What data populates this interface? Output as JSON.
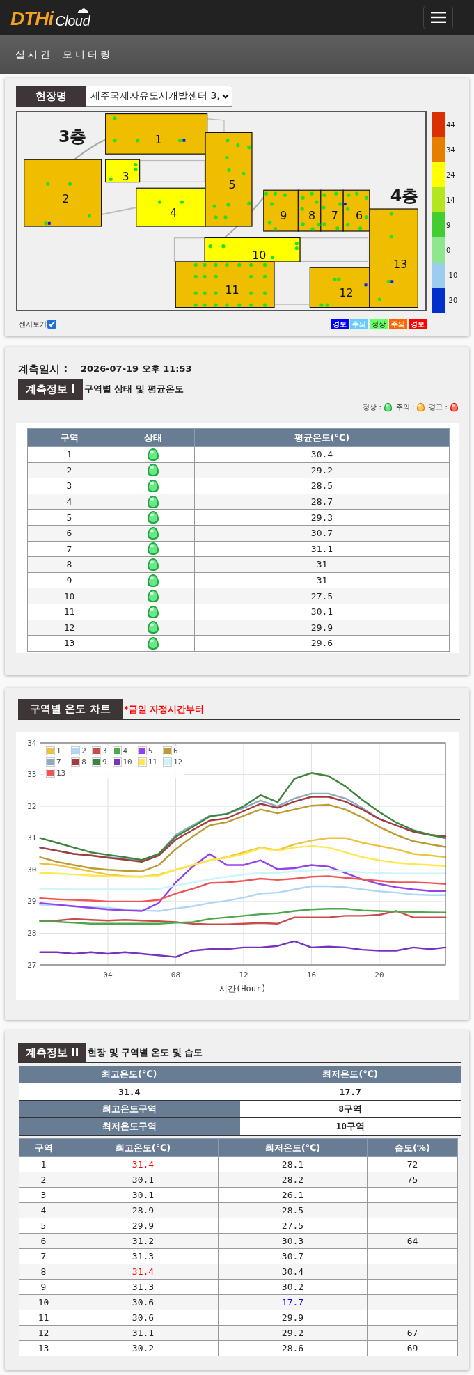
{
  "header": {
    "logo_brand": "DTHi",
    "logo_suffix": "Cloud"
  },
  "page_title": "실시간 모니터링",
  "site": {
    "label": "현장명",
    "selected_site": "제주국제자유도시개발센터 3,"
  },
  "map": {
    "floors": [
      {
        "label": "3층"
      },
      {
        "label": "4층"
      }
    ],
    "zones": [
      {
        "label": "1",
        "color": "#f0be00",
        "humidity_sensor": true
      },
      {
        "label": "2",
        "color": "#f0be00",
        "humidity_sensor": true
      },
      {
        "label": "3",
        "color": "#ffff00",
        "humidity_sensor": false
      },
      {
        "label": "4",
        "color": "#ffff00",
        "humidity_sensor": false
      },
      {
        "label": "5",
        "color": "#f0be00",
        "humidity_sensor": false
      },
      {
        "label": "9",
        "color": "#f0be00",
        "humidity_sensor": false
      },
      {
        "label": "8",
        "color": "#f0be00",
        "humidity_sensor": false
      },
      {
        "label": "7",
        "color": "#f0be00",
        "humidity_sensor": false
      },
      {
        "label": "6",
        "color": "#f0be00",
        "humidity_sensor": true
      },
      {
        "label": "10",
        "color": "#ffff00",
        "humidity_sensor": false
      },
      {
        "label": "11",
        "color": "#f0be00",
        "humidity_sensor": false
      },
      {
        "label": "12",
        "color": "#f0be00",
        "humidity_sensor": true
      },
      {
        "label": "13",
        "color": "#f0be00",
        "humidity_sensor": true
      }
    ],
    "color_scale": [
      {
        "label": "44",
        "color": "#d83000"
      },
      {
        "label": "34",
        "color": "#e67e00"
      },
      {
        "label": "24",
        "color": "#ffff00"
      },
      {
        "label": "14",
        "color": "#b4e61e"
      },
      {
        "label": "9",
        "color": "#44cc33"
      },
      {
        "label": "0",
        "color": "#8ee68e"
      },
      {
        "label": "-10",
        "color": "#9cccf0"
      },
      {
        "label": "-20",
        "color": "#0030cc"
      }
    ],
    "sensor_toggle": {
      "label": "센서보기",
      "checked": true
    },
    "alert_legend": [
      {
        "label": "경보",
        "color": "#0000ff"
      },
      {
        "label": "주의",
        "color": "#66ccff"
      },
      {
        "label": "정상",
        "color": "#66ff66"
      },
      {
        "label": "주의",
        "color": "#ff6600"
      },
      {
        "label": "경보",
        "color": "#ff0000"
      }
    ]
  },
  "measurement": {
    "time_label": "계측일시 :",
    "time": "2026-07-19 오후 11:53",
    "tab": "계측정보 I",
    "subtitle": "구역별 상태 및 평균온도",
    "status_legend": [
      {
        "label": "정상 :",
        "kind": "normal"
      },
      {
        "label": "주의 :",
        "kind": "caution"
      },
      {
        "label": "경고 :",
        "kind": "warning"
      }
    ],
    "table": {
      "columns": [
        "구역",
        "상태",
        "평균온도(℃)"
      ],
      "rows": [
        {
          "zone": "1",
          "kind": "normal",
          "avg": "30.4"
        },
        {
          "zone": "2",
          "kind": "normal",
          "avg": "29.2"
        },
        {
          "zone": "3",
          "kind": "normal",
          "avg": "28.5"
        },
        {
          "zone": "4",
          "kind": "normal",
          "avg": "28.7"
        },
        {
          "zone": "5",
          "kind": "normal",
          "avg": "29.3"
        },
        {
          "zone": "6",
          "kind": "normal",
          "avg": "30.7"
        },
        {
          "zone": "7",
          "kind": "normal",
          "avg": "31.1"
        },
        {
          "zone": "8",
          "kind": "normal",
          "avg": "31"
        },
        {
          "zone": "9",
          "kind": "normal",
          "avg": "31"
        },
        {
          "zone": "10",
          "kind": "normal",
          "avg": "27.5"
        },
        {
          "zone": "11",
          "kind": "normal",
          "avg": "30.1"
        },
        {
          "zone": "12",
          "kind": "normal",
          "avg": "29.9"
        },
        {
          "zone": "13",
          "kind": "normal",
          "avg": "29.6"
        }
      ]
    }
  },
  "chart_section": {
    "tab": "구역별 온도 차트",
    "note": "*금일 자정시간부터",
    "chart_data": {
      "type": "line",
      "xlabel": "시간(Hour)",
      "grid": true,
      "legend": true,
      "x": [
        0,
        1,
        2,
        3,
        4,
        5,
        6,
        7,
        8,
        9,
        10,
        11,
        12,
        13,
        14,
        15,
        16,
        17,
        18,
        19,
        20,
        21,
        22,
        23,
        23.9
      ],
      "xlim": [
        0,
        23.9
      ],
      "ylim": [
        27,
        34
      ],
      "xticks": [
        {
          "value": 4,
          "label": "04"
        },
        {
          "value": 8,
          "label": "08"
        },
        {
          "value": 12,
          "label": "12"
        },
        {
          "value": 16,
          "label": "16"
        },
        {
          "value": 20,
          "label": "20"
        }
      ],
      "yticks": [
        {
          "value": 27,
          "label": "27"
        },
        {
          "value": 28,
          "label": "28"
        },
        {
          "value": 29,
          "label": "29"
        },
        {
          "value": 30,
          "label": "30"
        },
        {
          "value": 31,
          "label": "31"
        },
        {
          "value": 32,
          "label": "32"
        },
        {
          "value": 33,
          "label": "33"
        },
        {
          "value": 34,
          "label": "34"
        }
      ],
      "series": [
        {
          "name": "1",
          "color": "#edc240",
          "values": [
            30.2,
            30.15,
            30.05,
            29.95,
            29.85,
            29.8,
            29.78,
            29.85,
            30.0,
            30.15,
            30.3,
            30.4,
            30.55,
            30.7,
            30.62,
            30.8,
            30.92,
            31.0,
            31.0,
            30.85,
            30.75,
            30.65,
            30.5,
            30.45,
            30.4
          ]
        },
        {
          "name": "2",
          "color": "#afd8f8",
          "values": [
            28.9,
            28.88,
            28.85,
            28.82,
            28.8,
            28.75,
            28.72,
            28.7,
            28.78,
            28.85,
            28.95,
            29.02,
            29.12,
            29.25,
            29.28,
            29.38,
            29.48,
            29.48,
            29.45,
            29.38,
            29.32,
            29.28,
            29.22,
            29.2,
            29.2
          ]
        },
        {
          "name": "3",
          "color": "#cb4b4b",
          "values": [
            28.4,
            28.4,
            28.45,
            28.42,
            28.4,
            28.42,
            28.4,
            28.38,
            28.35,
            28.3,
            28.28,
            28.28,
            28.3,
            28.32,
            28.3,
            28.5,
            28.5,
            28.5,
            28.55,
            28.55,
            28.58,
            28.7,
            28.5,
            28.5,
            28.5
          ]
        },
        {
          "name": "4",
          "color": "#4da74d",
          "values": [
            28.38,
            28.36,
            28.33,
            28.3,
            28.3,
            28.3,
            28.3,
            28.3,
            28.33,
            28.35,
            28.45,
            28.5,
            28.55,
            28.6,
            28.63,
            28.7,
            28.75,
            28.77,
            28.77,
            28.72,
            28.7,
            28.68,
            28.67,
            28.66,
            28.65
          ]
        },
        {
          "name": "5",
          "color": "#9440ed",
          "values": [
            28.95,
            28.9,
            28.85,
            28.8,
            28.75,
            28.72,
            28.7,
            28.95,
            29.6,
            30.1,
            30.5,
            30.15,
            30.15,
            30.3,
            30.02,
            30.05,
            30.15,
            30.1,
            29.9,
            29.7,
            29.55,
            29.45,
            29.38,
            29.33,
            29.33
          ]
        },
        {
          "name": "6",
          "color": "#bd9b33",
          "values": [
            30.4,
            30.25,
            30.15,
            30.05,
            30.0,
            29.97,
            29.95,
            30.15,
            30.65,
            31.05,
            31.4,
            31.5,
            31.7,
            31.9,
            31.78,
            31.9,
            32.02,
            32.05,
            31.9,
            31.65,
            31.35,
            31.1,
            30.9,
            30.8,
            30.72
          ]
        },
        {
          "name": "7",
          "color": "#8cacc6",
          "values": [
            30.7,
            30.6,
            30.5,
            30.45,
            30.4,
            30.35,
            30.28,
            30.5,
            31.1,
            31.4,
            31.7,
            31.75,
            31.95,
            32.18,
            32.0,
            32.25,
            32.4,
            32.4,
            32.25,
            31.95,
            31.6,
            31.4,
            31.2,
            31.1,
            31.05
          ]
        },
        {
          "name": "8",
          "color": "#a23c3c",
          "values": [
            30.7,
            30.6,
            30.5,
            30.45,
            30.38,
            30.32,
            30.25,
            30.45,
            30.95,
            31.25,
            31.55,
            31.62,
            31.85,
            32.08,
            31.95,
            32.15,
            32.3,
            32.3,
            32.15,
            31.9,
            31.6,
            31.4,
            31.2,
            31.1,
            31.05
          ]
        },
        {
          "name": "9",
          "color": "#3d853d",
          "values": [
            31.0,
            30.85,
            30.7,
            30.55,
            30.47,
            30.4,
            30.31,
            30.5,
            31.04,
            31.35,
            31.68,
            31.76,
            32.0,
            32.35,
            32.13,
            32.87,
            33.05,
            32.95,
            32.63,
            32.2,
            31.82,
            31.49,
            31.25,
            31.1,
            31.0
          ]
        },
        {
          "name": "10",
          "color": "#7633bd",
          "values": [
            27.4,
            27.4,
            27.35,
            27.4,
            27.35,
            27.4,
            27.35,
            27.3,
            27.25,
            27.45,
            27.5,
            27.5,
            27.55,
            27.55,
            27.6,
            27.75,
            27.55,
            27.58,
            27.55,
            27.48,
            27.45,
            27.45,
            27.55,
            27.5,
            27.55
          ]
        },
        {
          "name": "11",
          "color": "#ffe84c",
          "values": [
            29.9,
            29.88,
            29.85,
            29.82,
            29.8,
            29.78,
            29.78,
            29.82,
            30.0,
            30.15,
            30.3,
            30.38,
            30.5,
            30.68,
            30.6,
            30.7,
            30.75,
            30.7,
            30.55,
            30.4,
            30.3,
            30.22,
            30.18,
            30.15,
            30.12
          ]
        },
        {
          "name": "12",
          "color": "#c8f6fa",
          "values": [
            29.4,
            29.4,
            29.38,
            29.38,
            29.38,
            29.38,
            29.38,
            29.4,
            29.5,
            29.6,
            29.7,
            29.78,
            29.85,
            29.9,
            29.9,
            29.95,
            29.98,
            30.0,
            29.95,
            29.92,
            29.9,
            29.88,
            29.88,
            29.88,
            29.88
          ]
        },
        {
          "name": "13",
          "color": "#f05555",
          "values": [
            29.1,
            29.07,
            29.05,
            29.03,
            29.0,
            29.0,
            29.0,
            29.05,
            29.25,
            29.4,
            29.58,
            29.6,
            29.65,
            29.72,
            29.68,
            29.72,
            29.78,
            29.8,
            29.75,
            29.7,
            29.65,
            29.6,
            29.6,
            29.58,
            29.55
          ]
        }
      ]
    }
  },
  "detail": {
    "tab": "계측정보 II",
    "subtitle": "현장 및 구역별 온도 및 습도",
    "summary": {
      "columns": [
        "최고온도(℃)",
        "최저온도(℃)"
      ],
      "values": [
        "31.4",
        "17.7"
      ],
      "rows": [
        {
          "label": "최고온도구역",
          "value": "8구역"
        },
        {
          "label": "최저온도구역",
          "value": "10구역"
        }
      ]
    },
    "table": {
      "columns": [
        "구역",
        "최고온도(℃)",
        "최저온도(℃)",
        "습도(%)"
      ],
      "rows": [
        {
          "zone": "1",
          "max": "31.4",
          "max_highlight": true,
          "min": "28.1",
          "min_highlight": false,
          "humidity": "72"
        },
        {
          "zone": "2",
          "max": "30.1",
          "max_highlight": false,
          "min": "28.2",
          "min_highlight": false,
          "humidity": "75"
        },
        {
          "zone": "3",
          "max": "30.1",
          "max_highlight": false,
          "min": "26.1",
          "min_highlight": false
        },
        {
          "zone": "4",
          "max": "28.9",
          "max_highlight": false,
          "min": "28.5",
          "min_highlight": false
        },
        {
          "zone": "5",
          "max": "29.9",
          "max_highlight": false,
          "min": "27.5",
          "min_highlight": false
        },
        {
          "zone": "6",
          "max": "31.2",
          "max_highlight": false,
          "min": "30.3",
          "min_highlight": false,
          "humidity": "64"
        },
        {
          "zone": "7",
          "max": "31.3",
          "max_highlight": false,
          "min": "30.7",
          "min_highlight": false
        },
        {
          "zone": "8",
          "max": "31.4",
          "max_highlight": true,
          "min": "30.4",
          "min_highlight": false
        },
        {
          "zone": "9",
          "max": "31.3",
          "max_highlight": false,
          "min": "30.2",
          "min_highlight": false
        },
        {
          "zone": "10",
          "max": "30.6",
          "max_highlight": false,
          "min": "17.7",
          "min_highlight": true
        },
        {
          "zone": "11",
          "max": "30.6",
          "max_highlight": false,
          "min": "29.9",
          "min_highlight": false
        },
        {
          "zone": "12",
          "max": "31.1",
          "max_highlight": false,
          "min": "29.2",
          "min_highlight": false,
          "humidity": "67"
        },
        {
          "zone": "13",
          "max": "30.2",
          "max_highlight": false,
          "min": "28.6",
          "min_highlight": false,
          "humidity": "69"
        }
      ]
    }
  }
}
